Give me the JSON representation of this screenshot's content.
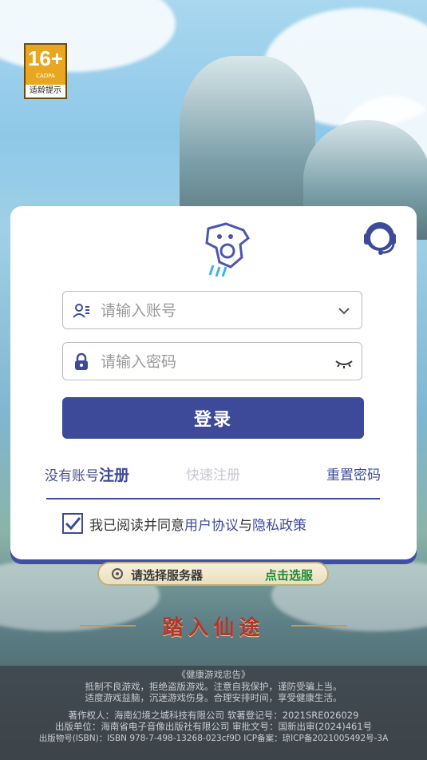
{
  "age_badge": {
    "age": "16+",
    "org": "CADPA",
    "tip": "适龄提示"
  },
  "login": {
    "account_placeholder": "请输入账号",
    "password_placeholder": "请输入密码",
    "login_button": "登录",
    "no_account": "没有账号",
    "register": "注册",
    "quick_register": "快速注册",
    "reset_password": "重置密码",
    "agree_prefix": "我已阅读并同意",
    "user_agreement": "用户协议",
    "and": "与",
    "privacy_policy": "隐私政策",
    "agree_checked": true
  },
  "server": {
    "select_label": "请选择服务器",
    "select_action": "点击选服"
  },
  "enter_label": "踏入仙途",
  "footer": {
    "title": "《健康游戏忠告》",
    "line1": "抵制不良游戏，拒绝盗版游戏。注意自我保护，谨防受骗上当。",
    "line2": "适度游戏益脑，沉迷游戏伤身。合理安排时间，享受健康生活。",
    "line3": "著作权人：海南幻境之城科技有限公司 软著登记号：2021SRE026029",
    "line4": "出版单位：海南省电子音像出版社有限公司 审批文号：国新出审(2024)461号",
    "line5": "出版物号(ISBN)：ISBN 978-7-498-13268-023cf9D ICP备案：琼ICP备2021005492号-3A"
  },
  "colors": {
    "primary": "#3d4a9a",
    "badge": "#e8a720"
  }
}
